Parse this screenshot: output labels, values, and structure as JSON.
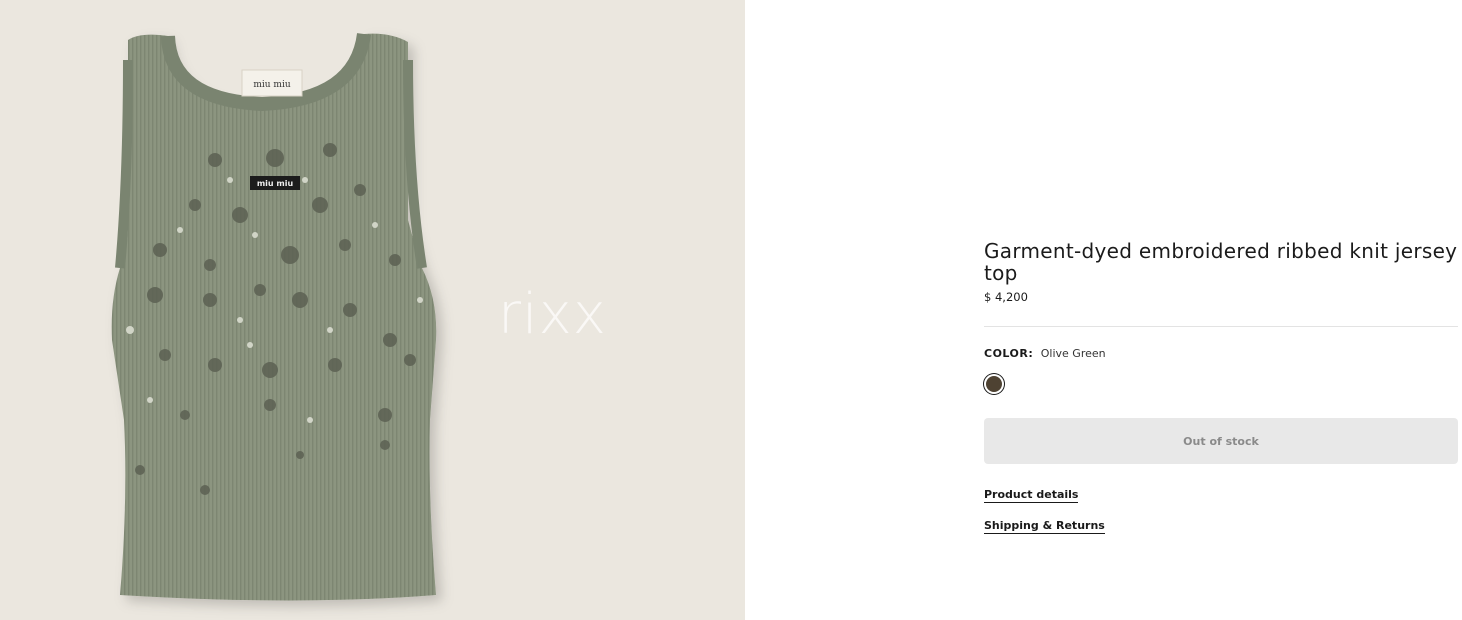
{
  "product": {
    "watermark": "rixx",
    "title": "Garment-dyed embroidered ribbed knit jersey top",
    "price": "$ 4,200",
    "color_label": "COLOR:",
    "color_value": "Olive Green",
    "swatch_color": "#4e4232",
    "stock_label": "Out of stock",
    "links": [
      "Product details",
      "Shipping & Returns"
    ],
    "label_text": "miu miu"
  }
}
